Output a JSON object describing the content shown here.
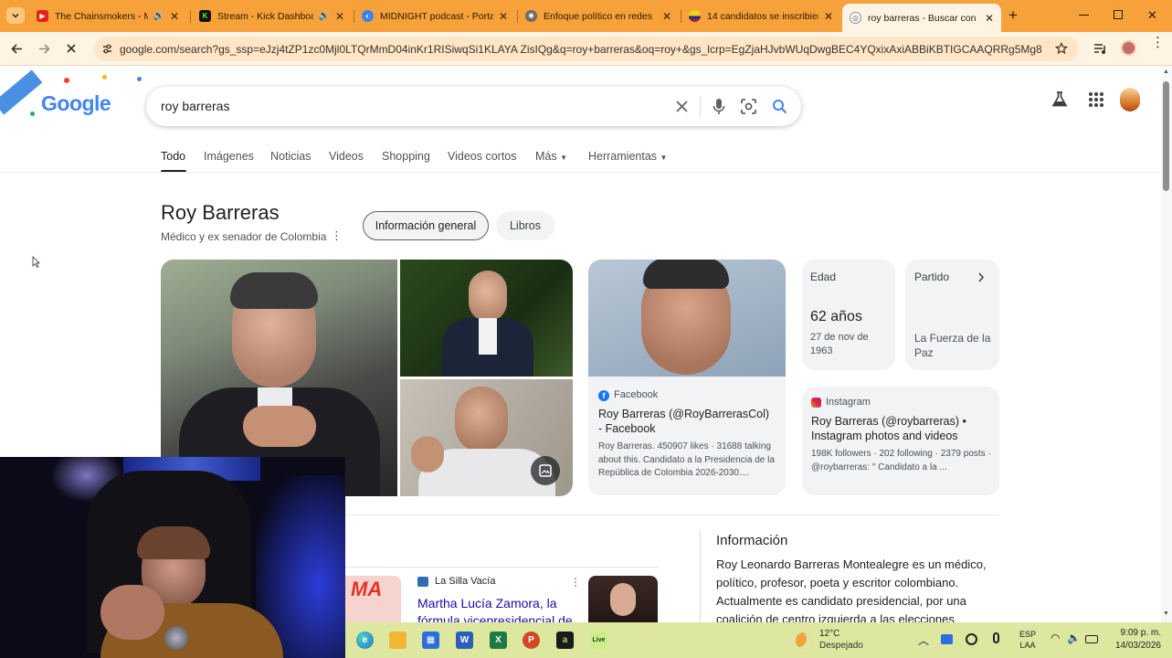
{
  "browser": {
    "tabs": [
      {
        "title": "The Chainsmokers - M",
        "favicon": "youtube-icon",
        "audio": true,
        "active": false
      },
      {
        "title": "Stream - Kick Dashboa",
        "favicon": "kick-icon",
        "audio": true,
        "active": false
      },
      {
        "title": "MIDNIGHT podcast - Porta",
        "favicon": "podcast-icon",
        "audio": false,
        "active": false
      },
      {
        "title": "Enfoque político en redes",
        "favicon": "openai-icon",
        "audio": false,
        "active": false
      },
      {
        "title": "14 candidatos se inscribier",
        "favicon": "colombia-flag-icon",
        "audio": false,
        "active": false
      },
      {
        "title": "roy barreras - Buscar con G",
        "favicon": "google-icon",
        "audio": false,
        "active": true
      }
    ],
    "new_tab_symbol": "+",
    "url": "google.com/search?gs_ssp=eJzj4tZP1zc0Mjl0LTQrMmD04inKr1RISiwqSi1KLAYA ZisIQg&q=roy+barreras&oq=roy+&gs_lcrp=EgZjaHJvbWUqDwgBEC4YQxixAxiABBiKBTIGCAAQRRg5Mg8IARAuGE..."
  },
  "google": {
    "query": "roy barreras",
    "logo_text": "Google",
    "tabs": [
      "Todo",
      "Imágenes",
      "Noticias",
      "Videos",
      "Shopping",
      "Videos cortos",
      "Más",
      "Herramientas"
    ],
    "active_tab": "Todo",
    "entity": {
      "name": "Roy Barreras",
      "description": "Médico y ex senador de Colombia",
      "chips": [
        "Información general",
        "Libros"
      ]
    },
    "facebook": {
      "source": "Facebook",
      "title": "Roy Barreras (@RoyBarrerasCol) - Facebook",
      "snippet": "Roy Barreras. 450907 likes · 31688 talking about this. Candidato a la Presidencia de la República de Colombia 2026-2030...."
    },
    "age": {
      "label": "Edad",
      "value": "62 años",
      "date": "27 de nov de 1963"
    },
    "party": {
      "label": "Partido",
      "value": "La Fuerza de la Paz"
    },
    "instagram": {
      "source": "Instagram",
      "title": "Roy Barreras (@roybarreras) • Instagram photos and videos",
      "snippet": "198K followers · 202 following · 2379 posts · @roybarreras: \" Candidato a la ..."
    },
    "news": {
      "source": "La Silla Vacía",
      "headline": "Martha Lucía Zamora, la fórmula vicepresidencial de",
      "thumb_text": "MA"
    },
    "info": {
      "heading": "Información",
      "text": "Roy Leonardo Barreras Montealegre  es un médico, político, profesor, poeta y escritor colombiano. Actualmente es candidato presidencial, por una coalición de centro izquierda a las elecciones"
    }
  },
  "taskbar": {
    "weather_temp": "12°C",
    "weather_desc": "Despejado",
    "lang": "ESP",
    "lang_sub": "LAA",
    "time": "9:09 p. m.",
    "date": "14/03/2026",
    "apps": [
      "edge-icon",
      "folder-icon",
      "store-icon",
      "word-icon",
      "excel-icon",
      "powerpoint-icon",
      "app-a-icon",
      "live-icon"
    ],
    "live_label": "Live"
  }
}
